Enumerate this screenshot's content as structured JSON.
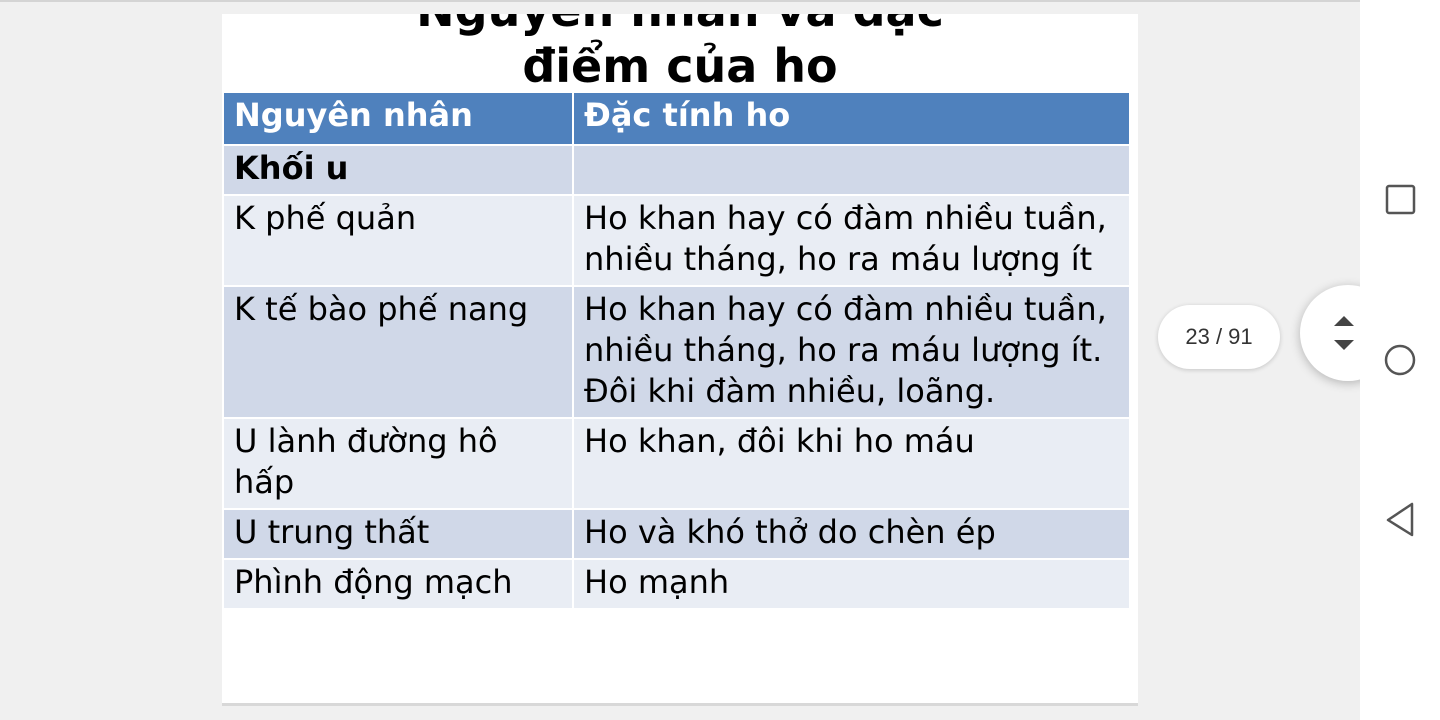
{
  "slide": {
    "title_line1": "Nguyên nhân và đặc",
    "title_line2": "điểm của ho",
    "table": {
      "headers": [
        "Nguyên nhân",
        "Đặc tính ho"
      ],
      "rows": [
        {
          "cause": "Khối u",
          "trait": ""
        },
        {
          "cause": "K phế quản",
          "trait": "Ho khan hay có đàm nhiều tuần, nhiều tháng, ho ra máu lượng ít"
        },
        {
          "cause": "K tế bào phế nang",
          "trait": "Ho khan hay có đàm nhiều tuần, nhiều tháng, ho ra máu lượng ít. Đôi khi đàm nhiều, loãng."
        },
        {
          "cause": "U lành đường hô hấp",
          "trait": "Ho khan, đôi khi ho máu"
        },
        {
          "cause": "U trung thất",
          "trait": "Ho và khó thở do chèn ép"
        },
        {
          "cause": "Phình động mạch",
          "trait": "Ho mạnh"
        }
      ]
    }
  },
  "viewer": {
    "page_indicator": "23 / 91",
    "scroll_button_icon": "scroll-up-down-icon"
  },
  "navbar": {
    "recent_icon": "square-icon",
    "home_icon": "circle-icon",
    "back_icon": "triangle-back-icon"
  },
  "colors": {
    "header_bg": "#4f81bd",
    "row_dark": "#d0d8e8",
    "row_light": "#e9edf4"
  }
}
